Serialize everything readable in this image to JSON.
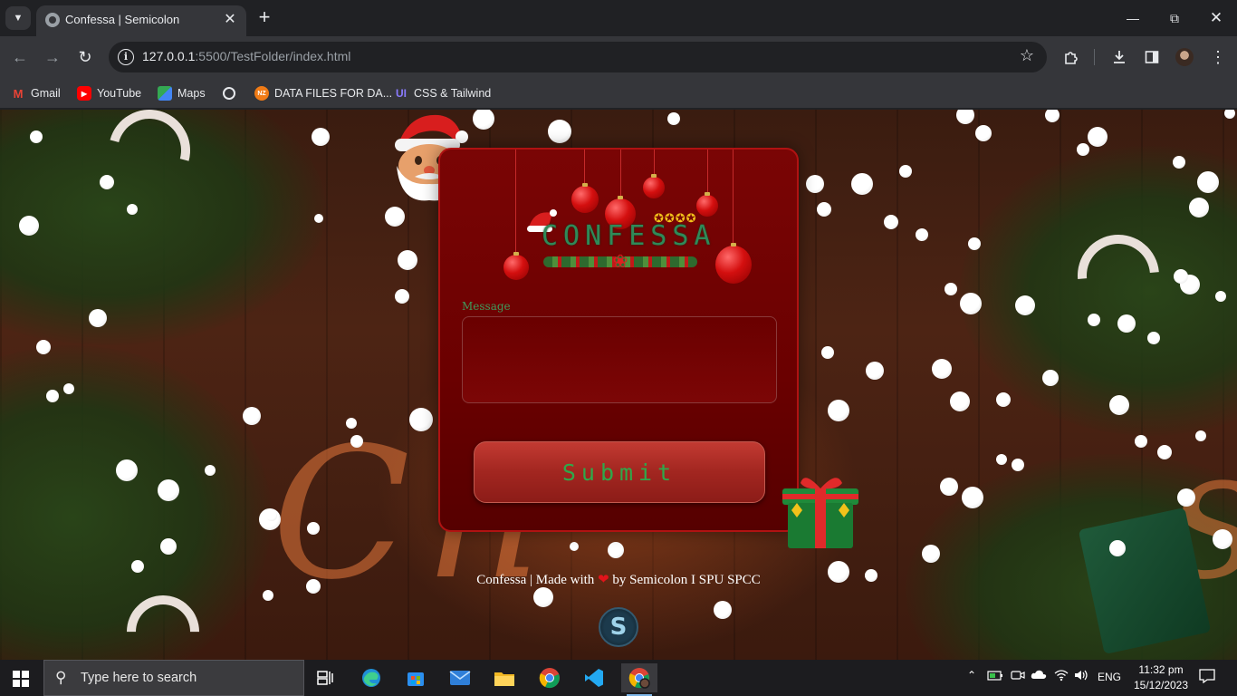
{
  "browser": {
    "tab_title": "Confessa | Semicolon",
    "tab_close": "✕",
    "new_tab": "+",
    "url_host": "127.0.0.1",
    "url_path": ":5500/TestFolder/index.html",
    "icons": [
      "tab-search-icon",
      "back-icon",
      "forward-icon",
      "reload-icon",
      "site-info-icon",
      "star-icon",
      "extensions-icon",
      "download-icon",
      "side-panel-icon",
      "profile-avatar",
      "menu-icon",
      "minimize-icon",
      "restore-icon",
      "close-icon"
    ]
  },
  "bookmarks": [
    {
      "label": "Gmail",
      "icon": "gmail-icon",
      "color": "#ea4335"
    },
    {
      "label": "YouTube",
      "icon": "youtube-icon",
      "color": "#ff0000"
    },
    {
      "label": "Maps",
      "icon": "maps-icon",
      "color": "#34a853"
    },
    {
      "label": "",
      "icon": "globe-icon",
      "color": "#e8eaed"
    },
    {
      "label": "DATA FILES FOR DA...",
      "icon": "nz-icon",
      "color": "#f07b16"
    },
    {
      "label": "CSS & Tailwind",
      "icon": "ui-icon",
      "color": "#6b5cff"
    }
  ],
  "page": {
    "logo_text": "CONFESSA",
    "message_label": "Message",
    "message_value": "",
    "submit_label": "Submit",
    "footer_before": "Confessa | Made with",
    "footer_after": "by Semicolon I SPU SPCC",
    "heart": "❤",
    "brand_mark": "S"
  },
  "taskbar": {
    "search_placeholder": "Type here to search",
    "apps": [
      "task-view-icon",
      "edge-icon",
      "store-icon",
      "mail-icon",
      "file-explorer-icon",
      "chrome-icon",
      "vscode-icon",
      "chrome-profile-icon"
    ],
    "language": "ENG",
    "time": "11:32 pm",
    "date": "15/12/2023"
  },
  "colors": {
    "card_bg": "#6a0000",
    "accent_green": "#2fa84a",
    "chrome_dark": "#202124",
    "chrome_toolbar": "#35363a"
  }
}
